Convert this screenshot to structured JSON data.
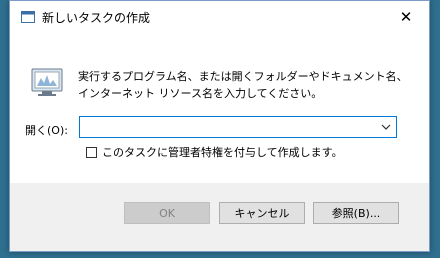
{
  "window": {
    "title": "新しいタスクの作成",
    "close_symbol": "✕"
  },
  "content": {
    "description": "実行するプログラム名、または開くフォルダーやドキュメント名、インターネット リソース名を入力してください。",
    "open_label": "開く(O):",
    "open_value": "",
    "admin_checkbox_label": "このタスクに管理者特権を付与して作成します。",
    "admin_checked": false
  },
  "buttons": {
    "ok": "OK",
    "cancel": "キャンセル",
    "browse": "参照(B)..."
  },
  "colors": {
    "accent": "#0078d7",
    "desktop": "#2f6f8f"
  }
}
